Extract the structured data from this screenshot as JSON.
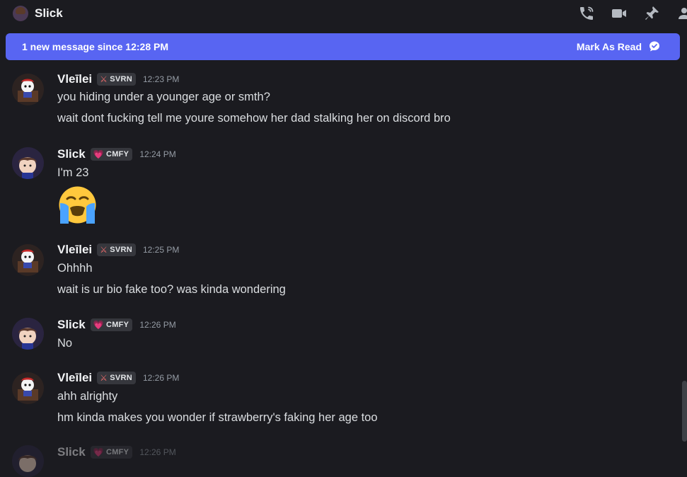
{
  "top_bar": {
    "title": "Slick",
    "icons": [
      "phone-icon",
      "video-icon",
      "pin-icon",
      "member-list-icon"
    ]
  },
  "banner": {
    "text": "1 new message since 12:28 PM",
    "action_label": "Mark As Read",
    "action_icon": "mark-read-icon",
    "color": "#5865f2"
  },
  "messages": [
    {
      "author": "Vleīlei",
      "tag": "SVRN",
      "tag_icon": "swords-icon",
      "time": "12:23 PM",
      "lines": [
        "you hiding under a younger age or smth?",
        "wait dont fucking tell me youre somehow her dad stalking her on discord bro"
      ]
    },
    {
      "author": "Slick",
      "tag": "CMFY",
      "tag_icon": "heart-icon",
      "time": "12:24 PM",
      "lines": [
        "I'm 23"
      ],
      "emoji": "loudly-crying-face-emoji"
    },
    {
      "author": "Vleīlei",
      "tag": "SVRN",
      "tag_icon": "swords-icon",
      "time": "12:25 PM",
      "lines": [
        "Ohhhh",
        "wait is ur bio fake too? was kinda wondering"
      ]
    },
    {
      "author": "Slick",
      "tag": "CMFY",
      "tag_icon": "heart-icon",
      "time": "12:26 PM",
      "lines": [
        "No"
      ]
    },
    {
      "author": "Vleīlei",
      "tag": "SVRN",
      "tag_icon": "swords-icon",
      "time": "12:26 PM",
      "lines": [
        "ahh alrighty",
        "hm kinda makes you wonder if strawberry's faking her age too"
      ]
    },
    {
      "author": "Slick",
      "tag": "CMFY",
      "tag_icon": "heart-icon",
      "time": "12:26 PM",
      "lines": []
    }
  ]
}
